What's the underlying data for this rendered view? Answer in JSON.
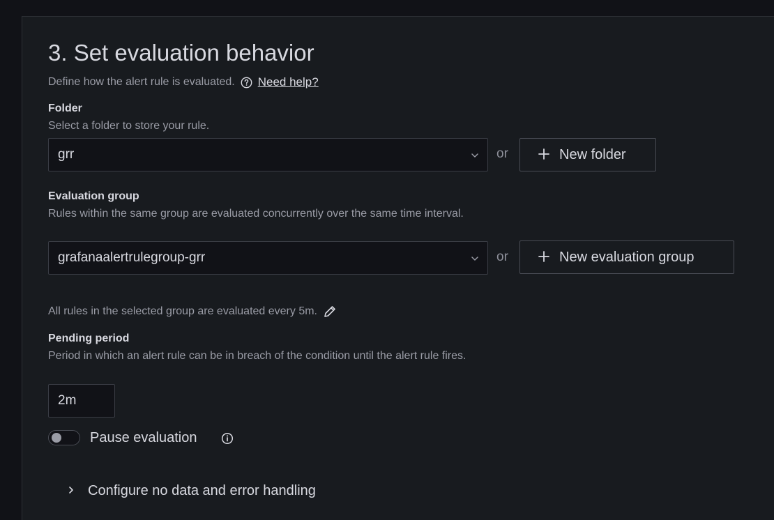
{
  "section": {
    "title": "3. Set evaluation behavior",
    "description": "Define how the alert rule is evaluated.",
    "help_link": "Need help?"
  },
  "folder": {
    "label": "Folder",
    "description": "Select a folder to store your rule.",
    "value": "grr",
    "or_text": "or",
    "new_button": "New folder"
  },
  "evaluation_group": {
    "label": "Evaluation group",
    "description": "Rules within the same group are evaluated concurrently over the same time interval.",
    "value": "grafanaalertrulegroup-grr",
    "or_text": "or",
    "new_button": "New evaluation group",
    "interval_note": "All rules in the selected group are evaluated every 5m."
  },
  "pending_period": {
    "label": "Pending period",
    "description": "Period in which an alert rule can be in breach of the condition until the alert rule fires.",
    "value": "2m"
  },
  "pause_evaluation": {
    "label": "Pause evaluation",
    "enabled": false
  },
  "no_data_section": {
    "label": "Configure no data and error handling"
  },
  "icons": {
    "help": "question-circle-icon",
    "chevron": "chevron-down-icon",
    "plus": "plus-icon",
    "edit": "pencil-icon",
    "info": "info-circle-icon",
    "expand": "chevron-right-icon"
  }
}
